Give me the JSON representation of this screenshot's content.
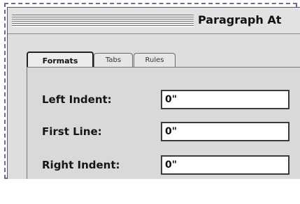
{
  "window": {
    "title": "Paragraph At"
  },
  "tabs": [
    {
      "label": "Formats",
      "active": true
    },
    {
      "label": "Tabs",
      "active": false
    },
    {
      "label": "Rules",
      "active": false
    }
  ],
  "fields": [
    {
      "label": "Left Indent:",
      "value": "0\""
    },
    {
      "label": "First Line:",
      "value": "0\""
    },
    {
      "label": "Right Indent:",
      "value": "0\""
    }
  ],
  "colors": {
    "selection_dash": "#6b6b96",
    "window_bg": "#dedede"
  }
}
